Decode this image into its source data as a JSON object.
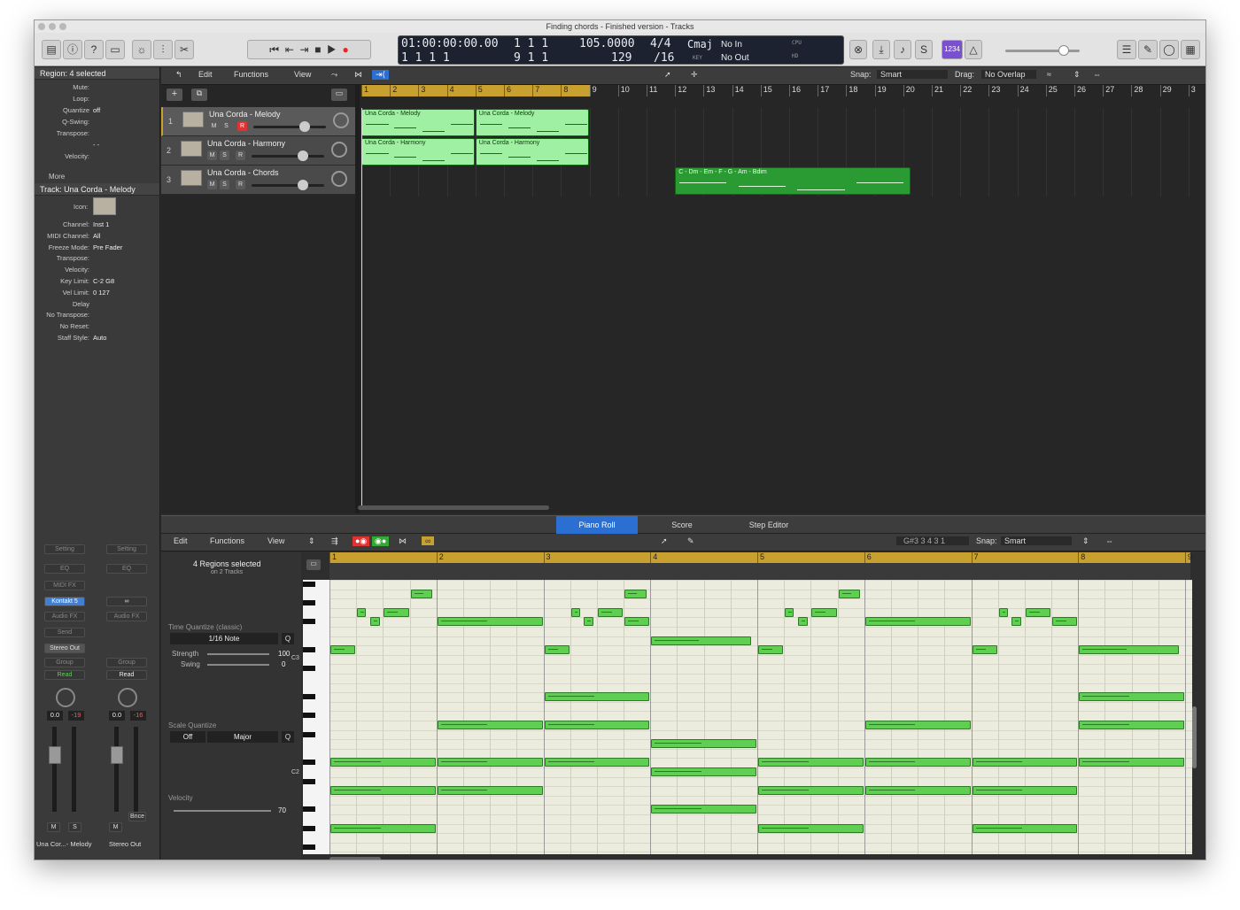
{
  "window": {
    "title": "Finding chords - Finished version - Tracks"
  },
  "transport": {
    "position_smpte": "01:00:00:00.00",
    "position_bars": "1  1  1",
    "position_bars2": "1 1 1   1",
    "position_bars3": "9  1  1",
    "tempo": "105.0000",
    "tempo_sub": "129",
    "signature": "4/4",
    "division": "/16",
    "key": "Cmaj",
    "key_label": "KEY",
    "in": "No In",
    "out": "No Out",
    "cpu_label": "CPU",
    "hd_label": "HD",
    "count_in": "1234"
  },
  "inspector": {
    "region_header": "Region: 4 selected",
    "region_params": [
      {
        "k": "Mute:",
        "v": ""
      },
      {
        "k": "Loop:",
        "v": ""
      },
      {
        "k": "Quantize",
        "v": "off"
      },
      {
        "k": "Q-Swing:",
        "v": ""
      },
      {
        "k": "Transpose:",
        "v": ""
      },
      {
        "k": "",
        "v": "- -"
      },
      {
        "k": "Velocity:",
        "v": ""
      }
    ],
    "more": "More",
    "track_header": "Track:  Una Corda - Melody",
    "track_icon_label": "Icon:",
    "track_params": [
      {
        "k": "Channel:",
        "v": "Inst 1"
      },
      {
        "k": "MIDI Channel:",
        "v": "All"
      },
      {
        "k": "Freeze Mode:",
        "v": "Pre Fader"
      },
      {
        "k": "Transpose:",
        "v": ""
      },
      {
        "k": "Velocity:",
        "v": ""
      },
      {
        "k": "Key Limit:",
        "v": "C-2      G8"
      },
      {
        "k": "Vel Limit:",
        "v": "0      127"
      },
      {
        "k": "Delay",
        "v": ""
      },
      {
        "k": "No Transpose:",
        "v": ""
      },
      {
        "k": "No Reset:",
        "v": ""
      },
      {
        "k": "Staff Style:",
        "v": "Auto"
      }
    ],
    "strip1": {
      "setting": "Setting",
      "eq": "EQ",
      "midifx": "MIDI FX",
      "instrument": "Kontakt 5",
      "audiofx": "Audio FX",
      "send": "Send",
      "output": "Stereo Out",
      "group": "Group",
      "auto": "Read",
      "vol": "0.0",
      "peak": "-19",
      "m": "M",
      "s": "S",
      "name": "Una Cor...- Melody"
    },
    "strip2": {
      "setting": "Setting",
      "eq": "EQ",
      "audiofx": "Audio FX",
      "group": "Group",
      "auto": "Read",
      "vol": "0.0",
      "peak": "-16",
      "m": "M",
      "bnce": "Bnce",
      "name": "Stereo Out"
    }
  },
  "tracks_menu": {
    "edit": "Edit",
    "functions": "Functions",
    "view": "View",
    "snap_label": "Snap:",
    "snap": "Smart",
    "drag_label": "Drag:",
    "drag": "No Overlap"
  },
  "tracks": [
    {
      "num": "1",
      "name": "Una Corda - Melody",
      "m": "M",
      "s": "S",
      "r": "R"
    },
    {
      "num": "2",
      "name": "Una Corda - Harmony",
      "m": "M",
      "s": "S",
      "r": "R"
    },
    {
      "num": "3",
      "name": "Una Corda - Chords",
      "m": "M",
      "s": "S",
      "r": "R"
    }
  ],
  "ruler": [
    "1",
    "2",
    "3",
    "4",
    "5",
    "6",
    "7",
    "8",
    "9",
    "10",
    "11",
    "12",
    "13",
    "14",
    "15",
    "16",
    "17",
    "18",
    "19",
    "20",
    "21",
    "22",
    "23",
    "24",
    "25",
    "26",
    "27",
    "28",
    "29",
    "3"
  ],
  "regions": [
    {
      "label": "Una Corda - Melody",
      "track": 0,
      "start": 1,
      "len": 4
    },
    {
      "label": "Una Corda - Melody",
      "track": 0,
      "start": 5,
      "len": 4
    },
    {
      "label": "Una Corda - Harmony",
      "track": 1,
      "start": 1,
      "len": 4
    },
    {
      "label": "Una Corda - Harmony",
      "track": 1,
      "start": 5,
      "len": 4
    },
    {
      "label": "C - Dm - Em - F - G - Am - Bdim",
      "track": 2,
      "start": 12,
      "len": 8.3
    }
  ],
  "editor": {
    "tabs": [
      "Piano Roll",
      "Score",
      "Step Editor"
    ],
    "edit": "Edit",
    "functions": "Functions",
    "view": "View",
    "position": "G#3  3 4 3 1",
    "snap_label": "Snap:",
    "snap": "Smart",
    "selection": "4 Regions selected",
    "selection_sub": "on 2 Tracks",
    "time_quantize_label": "Time Quantize (classic)",
    "time_quantize": "1/16 Note",
    "q": "Q",
    "strength_label": "Strength",
    "strength": "100",
    "swing_label": "Swing",
    "swing": "0",
    "scale_quantize_label": "Scale Quantize",
    "scale_off": "Off",
    "scale_mode": "Major",
    "velocity_label": "Velocity",
    "velocity": "70",
    "ruler": [
      "1",
      "2",
      "3",
      "4",
      "5",
      "6",
      "7",
      "8",
      "9"
    ],
    "c3": "C3",
    "c2": "C2"
  },
  "notes": [
    {
      "b": 1.75,
      "l": 0.22,
      "r": 1
    },
    {
      "b": 1.25,
      "l": 0.1,
      "r": 3
    },
    {
      "b": 1.37,
      "l": 0.11,
      "r": 4
    },
    {
      "b": 1.5,
      "l": 0.25,
      "r": 3
    },
    {
      "b": 1.0,
      "l": 0.25,
      "r": 7
    },
    {
      "b": 2.0,
      "l": 1.0,
      "r": 4
    },
    {
      "b": 3.75,
      "l": 0.22,
      "r": 1
    },
    {
      "b": 3.25,
      "l": 0.1,
      "r": 3
    },
    {
      "b": 3.37,
      "l": 0.11,
      "r": 4
    },
    {
      "b": 3.5,
      "l": 0.25,
      "r": 3
    },
    {
      "b": 3.75,
      "l": 0.25,
      "r": 4
    },
    {
      "b": 3.0,
      "l": 0.25,
      "r": 7
    },
    {
      "b": 4.0,
      "l": 0.95,
      "r": 6
    },
    {
      "b": 5.75,
      "l": 0.22,
      "r": 1
    },
    {
      "b": 5.25,
      "l": 0.1,
      "r": 3
    },
    {
      "b": 5.37,
      "l": 0.11,
      "r": 4
    },
    {
      "b": 5.5,
      "l": 0.25,
      "r": 3
    },
    {
      "b": 5.0,
      "l": 0.25,
      "r": 7
    },
    {
      "b": 6.0,
      "l": 1.0,
      "r": 4
    },
    {
      "b": 7.25,
      "l": 0.1,
      "r": 3
    },
    {
      "b": 7.37,
      "l": 0.11,
      "r": 4
    },
    {
      "b": 7.5,
      "l": 0.25,
      "r": 3
    },
    {
      "b": 7.75,
      "l": 0.25,
      "r": 4
    },
    {
      "b": 7.0,
      "l": 0.25,
      "r": 7
    },
    {
      "b": 8.0,
      "l": 0.95,
      "r": 7
    },
    {
      "b": 3.0,
      "l": 1.0,
      "r": 12
    },
    {
      "b": 8.0,
      "l": 1.0,
      "r": 12
    },
    {
      "b": 2.0,
      "l": 1.0,
      "r": 15
    },
    {
      "b": 3.0,
      "l": 1.0,
      "r": 15
    },
    {
      "b": 6.0,
      "l": 1.0,
      "r": 15
    },
    {
      "b": 8.0,
      "l": 1.0,
      "r": 15
    },
    {
      "b": 4.0,
      "l": 1.0,
      "r": 17
    },
    {
      "b": 1.0,
      "l": 1.0,
      "r": 19
    },
    {
      "b": 2.0,
      "l": 1.0,
      "r": 19
    },
    {
      "b": 3.0,
      "l": 1.0,
      "r": 19
    },
    {
      "b": 5.0,
      "l": 1.0,
      "r": 19
    },
    {
      "b": 6.0,
      "l": 1.0,
      "r": 19
    },
    {
      "b": 7.0,
      "l": 1.0,
      "r": 19
    },
    {
      "b": 8.0,
      "l": 1.0,
      "r": 19
    },
    {
      "b": 4.0,
      "l": 1.0,
      "r": 20
    },
    {
      "b": 1.0,
      "l": 1.0,
      "r": 22
    },
    {
      "b": 2.0,
      "l": 1.0,
      "r": 22
    },
    {
      "b": 5.0,
      "l": 1.0,
      "r": 22
    },
    {
      "b": 6.0,
      "l": 1.0,
      "r": 22
    },
    {
      "b": 7.0,
      "l": 1.0,
      "r": 22
    },
    {
      "b": 4.0,
      "l": 1.0,
      "r": 24
    },
    {
      "b": 1.0,
      "l": 1.0,
      "r": 26
    },
    {
      "b": 5.0,
      "l": 1.0,
      "r": 26
    },
    {
      "b": 7.0,
      "l": 1.0,
      "r": 26
    }
  ]
}
